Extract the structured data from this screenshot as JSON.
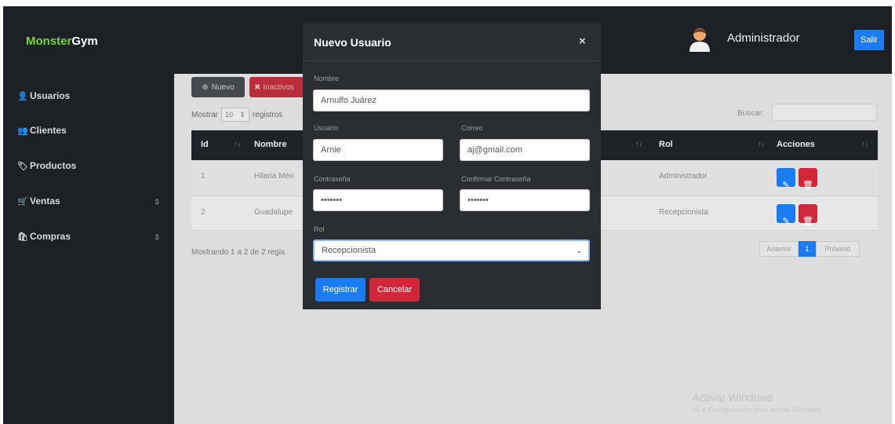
{
  "brand": {
    "part1": "Monster",
    "part2": "Gym"
  },
  "header": {
    "user_name": "Administrador",
    "logout_label": "Salir"
  },
  "sidebar": {
    "items": [
      {
        "icon": "👤",
        "label": "Usuarios",
        "caret": ""
      },
      {
        "icon": "👥",
        "label": "Clientes",
        "caret": ""
      },
      {
        "icon": "🏷",
        "label": "Productos",
        "caret": ""
      },
      {
        "icon": "🛒",
        "label": "Ventas",
        "caret": "▯"
      },
      {
        "icon": "🛍",
        "label": "Compras",
        "caret": "▯"
      }
    ]
  },
  "toolbar": {
    "new_label": "Nuevo",
    "inactive_label": "Inactivos"
  },
  "list_controls": {
    "show_label": "Mostrar",
    "page_size": "10",
    "records_label": "registros",
    "search_label": "Buscar:"
  },
  "table": {
    "columns": {
      "id": "Id",
      "nombre": "Nombre",
      "rol": "Rol",
      "acciones": "Acciones"
    },
    "rows": [
      {
        "id": "1",
        "nombre": "Hilaria Mén",
        "rol": "Administrador"
      },
      {
        "id": "2",
        "nombre": "Guadalupe",
        "rol": "Recepcionista"
      }
    ]
  },
  "footer": {
    "info": "Mostrando 1 a 2 de 2 regis",
    "prev": "Anterior",
    "page": "1",
    "next": "Próximo"
  },
  "watermark": {
    "line1": "Activar Windows",
    "line2": "Ve a Configuración para activar Windows."
  },
  "modal": {
    "title": "Nuevo Usuario",
    "close": "×",
    "nombre_label": "Nombre",
    "nombre_value": "Arnulfo Juárez",
    "usuario_label": "Usuario",
    "usuario_value": "Arnie",
    "correo_label": "Correo",
    "correo_value": "aj@gmail.com",
    "password_label": "Contraseña",
    "password_value": "•••••••",
    "confirm_label": "Confirmar Contraseña",
    "confirm_value": "•••••••",
    "rol_label": "Rol",
    "rol_value": "Recepcionista",
    "submit_label": "Registrar",
    "cancel_label": "Cancelar"
  }
}
